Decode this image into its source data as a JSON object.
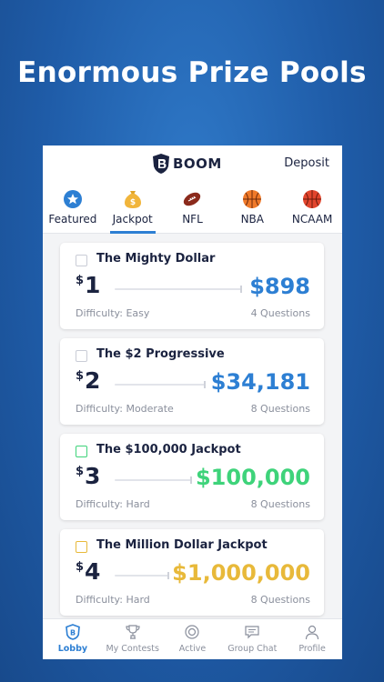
{
  "headline": "Enormous Prize Pools",
  "header": {
    "brand": "BOOM",
    "deposit_label": "Deposit"
  },
  "tabs": [
    {
      "label": "Featured",
      "icon": "star-icon"
    },
    {
      "label": "Jackpot",
      "icon": "money-bag-icon",
      "active": true
    },
    {
      "label": "NFL",
      "icon": "football-icon"
    },
    {
      "label": "NBA",
      "icon": "basketball-icon"
    },
    {
      "label": "NCAAM",
      "icon": "basketball-icon"
    }
  ],
  "contests": [
    {
      "title": "The Mighty Dollar",
      "currency": "$",
      "entry": "1",
      "prize": "$898",
      "difficulty": "Difficulty: Easy",
      "questions": "4 Questions",
      "color": "#2d7fd3"
    },
    {
      "title": "The $2 Progressive",
      "currency": "$",
      "entry": "2",
      "prize": "$34,181",
      "difficulty": "Difficulty: Moderate",
      "questions": "8 Questions",
      "color": "#2d7fd3"
    },
    {
      "title": "The $100,000 Jackpot",
      "currency": "$",
      "entry": "3",
      "prize": "$100,000",
      "difficulty": "Difficulty: Hard",
      "questions": "8 Questions",
      "color": "#3ed37a"
    },
    {
      "title": "The Million Dollar Jackpot",
      "currency": "$",
      "entry": "4",
      "prize": "$1,000,000",
      "difficulty": "Difficulty: Hard",
      "questions": "8 Questions",
      "color": "#e8b93a"
    }
  ],
  "bottom_nav": [
    {
      "label": "Lobby",
      "icon": "boom-shield-icon",
      "active": true
    },
    {
      "label": "My Contests",
      "icon": "trophy-icon"
    },
    {
      "label": "Active",
      "icon": "target-icon"
    },
    {
      "label": "Group Chat",
      "icon": "chat-icon"
    },
    {
      "label": "Profile",
      "icon": "person-icon"
    }
  ],
  "colors": {
    "accent": "#2d7fd3",
    "navy": "#1b2340",
    "green": "#3ed37a",
    "gold": "#e8b93a"
  }
}
